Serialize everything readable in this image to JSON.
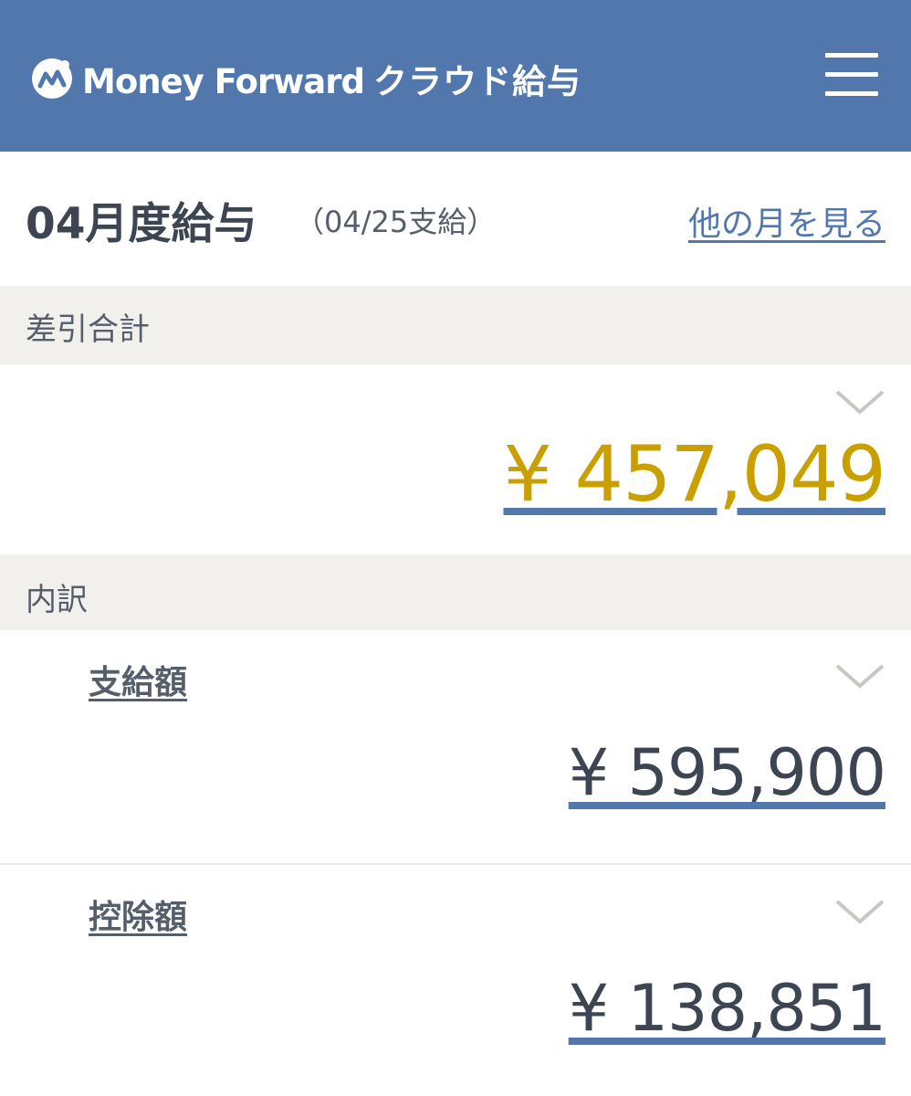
{
  "header": {
    "logo_text": "Money Forward",
    "product_name": "クラウド給与",
    "menu_icon": "hamburger-menu-icon",
    "background_color": "#5177ad"
  },
  "title_row": {
    "title": "04月度給与",
    "pay_date": "（04/25支給）",
    "other_month_link": "他の月を見る"
  },
  "net_total": {
    "section_label": "差引合計",
    "amount": "¥ 457,049",
    "amount_color": "#c9a000"
  },
  "breakdown": {
    "section_label": "内訳",
    "items": [
      {
        "label": "支給額",
        "amount": "¥ 595,900"
      },
      {
        "label": "控除額",
        "amount": "¥ 138,851"
      }
    ]
  }
}
